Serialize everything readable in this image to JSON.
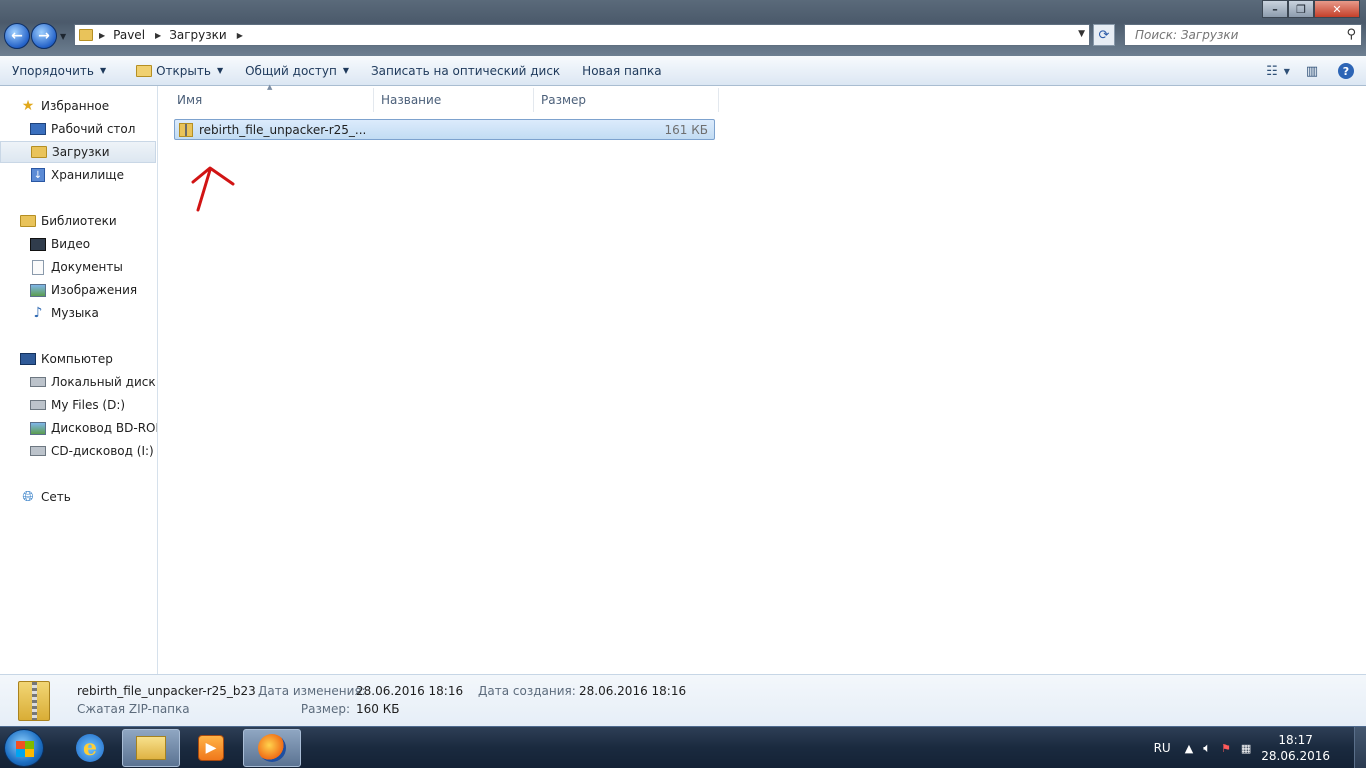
{
  "window": {
    "breadcrumb": [
      "Pavel",
      "Загрузки"
    ],
    "search_placeholder": "Поиск: Загрузки"
  },
  "toolbar": {
    "organize": "Упорядочить",
    "open": "Открыть",
    "share": "Общий доступ",
    "burn": "Записать на оптический диск",
    "new_folder": "Новая папка"
  },
  "navigation": {
    "favorites": {
      "label": "Избранное",
      "items": [
        {
          "label": "Рабочий стол",
          "icon": "desktop-icon"
        },
        {
          "label": "Загрузки",
          "icon": "downloads-folder-icon",
          "selected": true
        },
        {
          "label": "Хранилище",
          "icon": "storage-icon"
        }
      ]
    },
    "libraries": {
      "label": "Библиотеки",
      "items": [
        {
          "label": "Видео",
          "icon": "video-icon"
        },
        {
          "label": "Документы",
          "icon": "documents-icon"
        },
        {
          "label": "Изображения",
          "icon": "images-icon"
        },
        {
          "label": "Музыка",
          "icon": "music-icon"
        }
      ]
    },
    "computer": {
      "label": "Компьютер",
      "items": [
        {
          "label": "Локальный диск (",
          "icon": "local-disk-icon"
        },
        {
          "label": "My Files (D:)",
          "icon": "drive-icon"
        },
        {
          "label": "Дисковод BD-ROM",
          "icon": "bd-rom-icon"
        },
        {
          "label": "CD-дисковод (I:) B",
          "icon": "cd-drive-icon"
        }
      ]
    },
    "network": {
      "label": "Сеть"
    }
  },
  "file_list": {
    "columns": [
      "Имя",
      "Название",
      "Размер"
    ],
    "rows": [
      {
        "name": "rebirth_file_unpacker-r25_...",
        "size": "161 КБ"
      }
    ]
  },
  "details": {
    "name": "rebirth_file_unpacker-r25_b23",
    "type": "Сжатая ZIP-папка",
    "modified_label": "Дата изменения:",
    "modified_value": "28.06.2016 18:16",
    "size_label": "Размер:",
    "size_value": "160 КБ",
    "created_label": "Дата создания:",
    "created_value": "28.06.2016 18:16"
  },
  "taskbar": {
    "language": "RU",
    "time": "18:17",
    "date": "28.06.2016"
  },
  "colors": {
    "selection": "#cce4f7",
    "annotation": "#d11414",
    "taskbar": "#1a2a3f"
  }
}
